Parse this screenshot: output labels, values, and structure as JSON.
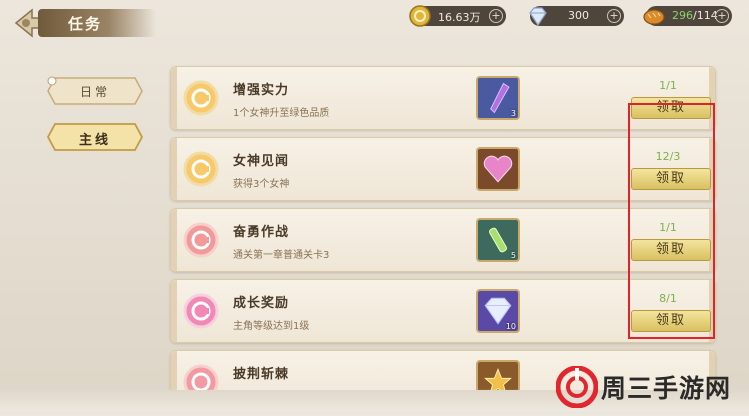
{
  "header": {
    "title": "任务"
  },
  "resources": {
    "gold": {
      "value": "16.63万",
      "icon": "gold-coin-icon"
    },
    "diamond": {
      "value": "300",
      "icon": "diamond-icon"
    },
    "stamina": {
      "current": "296",
      "max": "/114",
      "icon": "bread-icon"
    }
  },
  "side_tabs": [
    {
      "label": "日常",
      "active": false
    },
    {
      "label": "主线",
      "active": true
    }
  ],
  "tasks": [
    {
      "name": "增强实力",
      "desc": "1个女神升至绿色品质",
      "progress": "1/1",
      "claim_label": "领取",
      "reward_icon": "purple-crystal-icon",
      "reward_count": "3",
      "coin_color": "gold"
    },
    {
      "name": "女神见闻",
      "desc": "获得3个女神",
      "progress": "12/3",
      "claim_label": "领取",
      "reward_icon": "pink-heart-gem-icon",
      "reward_count": "",
      "coin_color": "gold"
    },
    {
      "name": "奋勇作战",
      "desc": "通关第一章普通关卡3",
      "progress": "1/1",
      "claim_label": "领取",
      "reward_icon": "green-potion-icon",
      "reward_count": "5",
      "coin_color": "pink"
    },
    {
      "name": "成长奖励",
      "desc": "主角等级达到1级",
      "progress": "8/1",
      "claim_label": "领取",
      "reward_icon": "diamond-icon",
      "reward_count": "10",
      "coin_color": "pink"
    },
    {
      "name": "披荆斩棘",
      "desc": "",
      "progress": "",
      "claim_label": "",
      "reward_icon": "gold-star-icon",
      "reward_count": "",
      "coin_color": "pink"
    }
  ],
  "watermark": {
    "text": "周三手游网"
  },
  "colors": {
    "highlight": "#e0222a",
    "progress_green": "#7ab24b",
    "claim_button": "#f4e59e"
  }
}
